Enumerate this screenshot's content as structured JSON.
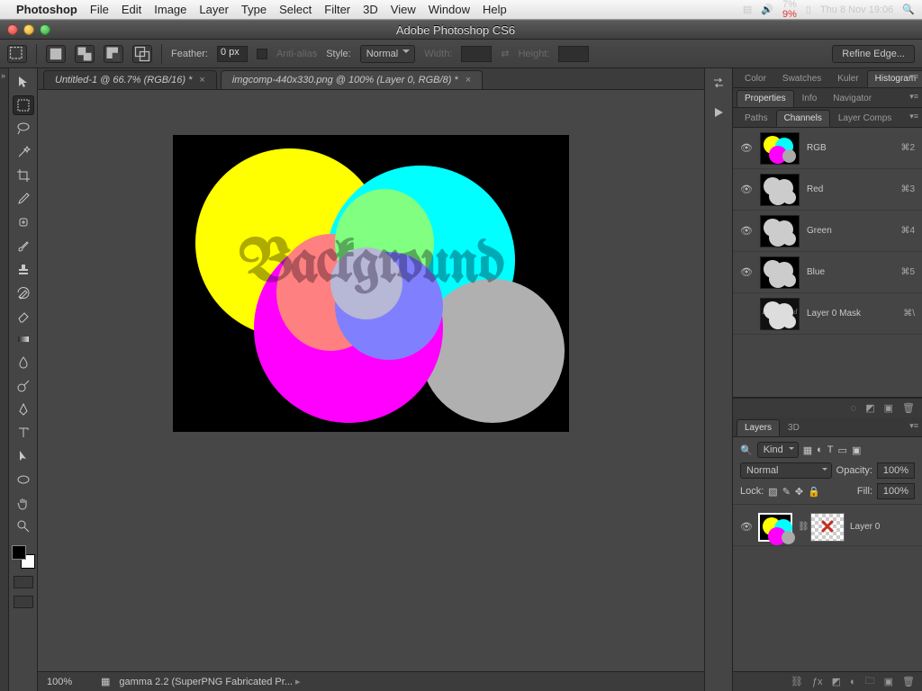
{
  "mac_menu": {
    "app": "Photoshop",
    "items": [
      "File",
      "Edit",
      "Image",
      "Layer",
      "Type",
      "Select",
      "Filter",
      "3D",
      "View",
      "Window",
      "Help"
    ],
    "battery": {
      "top": "7%",
      "bottom": "9%"
    },
    "clock": "Thu 8 Nov  19:06"
  },
  "window": {
    "title": "Adobe Photoshop CS6"
  },
  "options": {
    "feather_label": "Feather:",
    "feather_value": "0 px",
    "antialias_label": "Anti-alias",
    "style_label": "Style:",
    "style_value": "Normal",
    "width_label": "Width:",
    "height_label": "Height:",
    "refine_label": "Refine Edge..."
  },
  "doc_tabs": [
    {
      "label": "Untitled-1 @ 66.7% (RGB/16) *",
      "active": false
    },
    {
      "label": "imgcomp-440x330.png @ 100% (Layer 0, RGB/8) *",
      "active": true
    }
  ],
  "canvas_text": "Background",
  "statusbar": {
    "zoom": "100%",
    "info": "gamma 2.2 (SuperPNG Fabricated Pr..."
  },
  "panel_tabs": {
    "row1": [
      "Color",
      "Swatches",
      "Kuler",
      "Histogram"
    ],
    "row1_active": 3,
    "row2": [
      "Properties",
      "Info",
      "Navigator"
    ],
    "row2_active": 0,
    "row3": [
      "Paths",
      "Channels",
      "Layer Comps"
    ],
    "row3_active": 1,
    "row4": [
      "Layers",
      "3D"
    ],
    "row4_active": 0
  },
  "channels": [
    {
      "name": "RGB",
      "shortcut": "⌘2",
      "kind": "rgb",
      "vis": true
    },
    {
      "name": "Red",
      "shortcut": "⌘3",
      "kind": "gray",
      "vis": true
    },
    {
      "name": "Green",
      "shortcut": "⌘4",
      "kind": "gray",
      "vis": true
    },
    {
      "name": "Blue",
      "shortcut": "⌘5",
      "kind": "gray",
      "vis": true
    },
    {
      "name": "Layer 0 Mask",
      "shortcut": "⌘\\",
      "kind": "mask",
      "vis": false
    }
  ],
  "layers_panel": {
    "kind_label": "Kind",
    "blend_mode": "Normal",
    "opacity_label": "Opacity:",
    "opacity_value": "100%",
    "lock_label": "Lock:",
    "fill_label": "Fill:",
    "fill_value": "100%",
    "layer0": "Layer 0"
  }
}
